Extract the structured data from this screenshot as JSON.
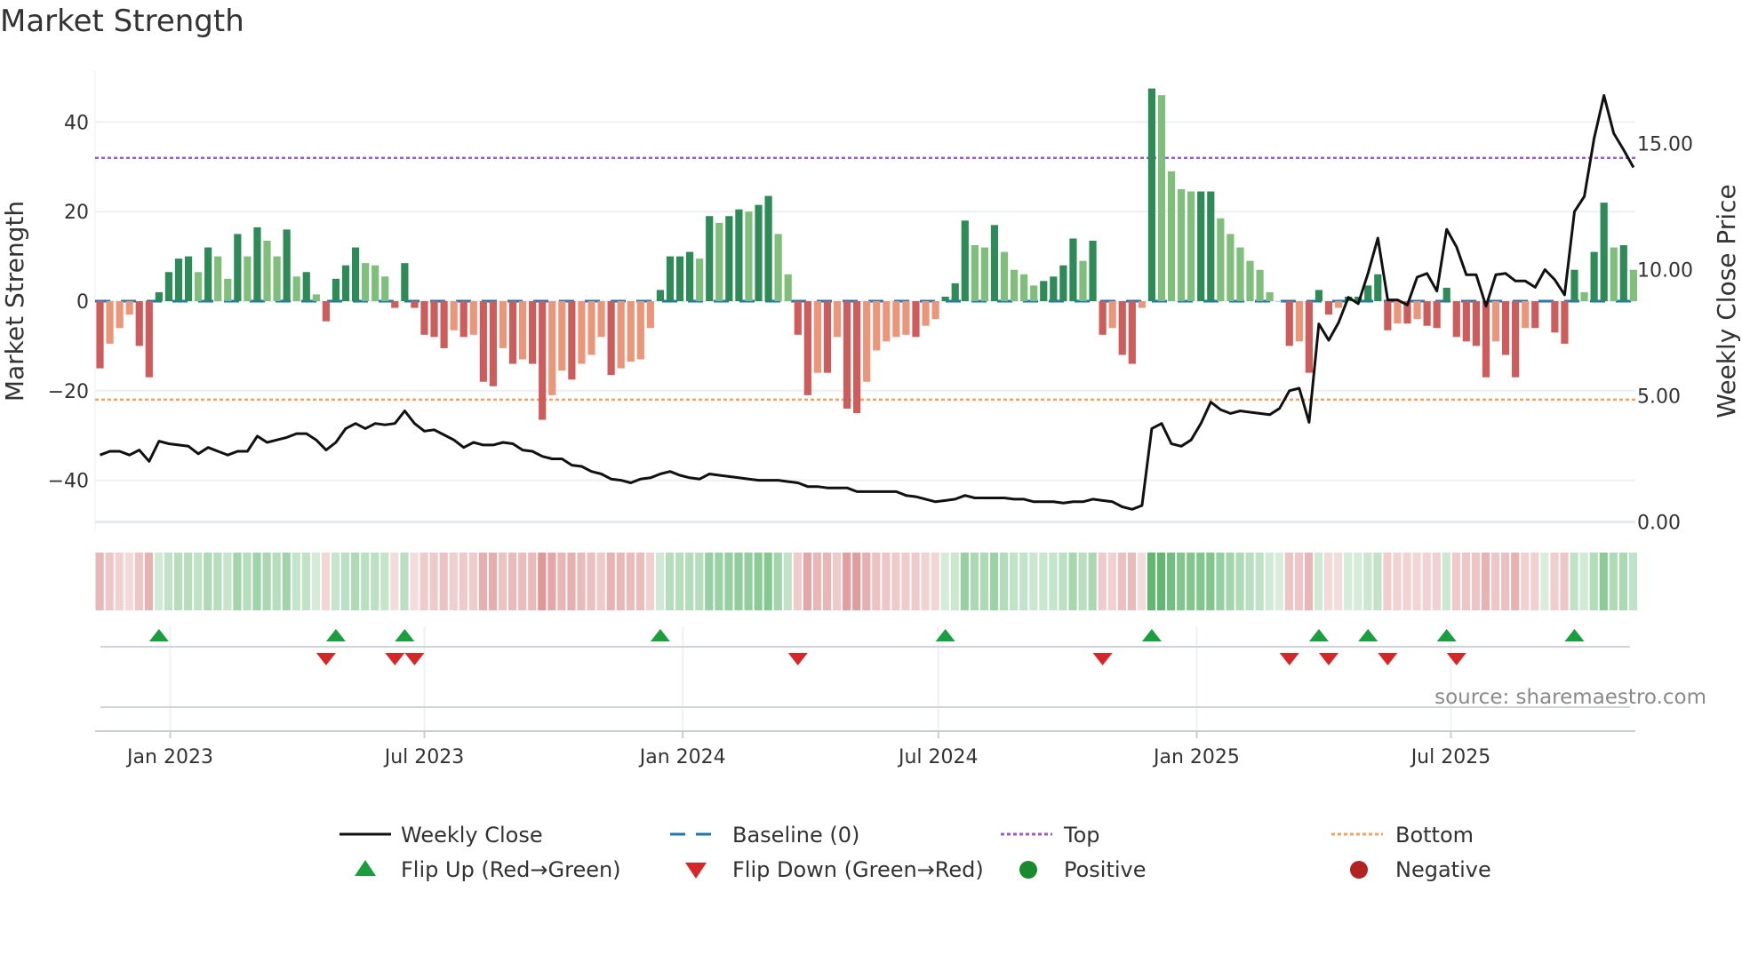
{
  "title": "Market Strength",
  "source": "source: sharemaestro.com",
  "chart_data": {
    "type": "bar",
    "title": "Market Strength",
    "start_date": "2022-11-12",
    "frequency": "weekly",
    "ylabel": "Market Strength",
    "y2label": "Weekly Close Price",
    "ylim": [
      -50,
      52
    ],
    "y2lim": [
      0,
      20.6
    ],
    "yticks": [
      {
        "v": 40,
        "label": "40"
      },
      {
        "v": 20,
        "label": "20"
      },
      {
        "v": 0,
        "label": "0"
      },
      {
        "v": -20,
        "label": "−20"
      },
      {
        "v": -40,
        "label": "−40"
      }
    ],
    "y2ticks": [
      {
        "v": 15,
        "label": "15.00"
      },
      {
        "v": 10,
        "label": "10.00"
      },
      {
        "v": 5,
        "label": "5.00"
      },
      {
        "v": 0,
        "label": "0.00"
      }
    ],
    "xticks": [
      {
        "label": "Jan 2023",
        "date": "2023-01-01"
      },
      {
        "label": "Jul 2023",
        "date": "2023-07-01"
      },
      {
        "label": "Jan 2024",
        "date": "2024-01-01"
      },
      {
        "label": "Jul 2024",
        "date": "2024-07-01"
      },
      {
        "label": "Jan 2025",
        "date": "2025-01-01"
      },
      {
        "label": "Jul 2025",
        "date": "2025-07-01"
      }
    ],
    "top_level": 32,
    "bottom_level": -22,
    "baseline": 0,
    "strength": [
      -15,
      -9.5,
      -6,
      -3,
      -10,
      -17,
      2,
      6.5,
      9.5,
      10,
      6.5,
      12,
      10,
      5,
      15,
      10,
      16.5,
      13.5,
      10,
      16,
      5.5,
      6.5,
      1.5,
      -4.5,
      5,
      8,
      12,
      8.5,
      8,
      5.5,
      -1.5,
      8.5,
      -1.5,
      -7.5,
      -8,
      -10.5,
      -6.5,
      -8,
      -7.5,
      -18,
      -19,
      -10.5,
      -14,
      -13,
      -14,
      -26.5,
      -21,
      -15.5,
      -17.5,
      -14,
      -12,
      -8,
      -16.5,
      -15,
      -13.5,
      -13,
      -6,
      2.5,
      10,
      10,
      11,
      9.5,
      19,
      17.5,
      19,
      20.5,
      20,
      21.5,
      23.5,
      15,
      6,
      -7.5,
      -21,
      -16,
      -16,
      -8,
      -24,
      -25,
      -18,
      -11,
      -9,
      -8,
      -7.5,
      -8,
      -5.5,
      -4,
      1,
      4,
      18,
      12.5,
      12,
      17,
      11,
      7,
      6,
      3.5,
      4.5,
      5.5,
      8,
      14,
      9,
      13.5,
      -7.5,
      -6,
      -12,
      -14,
      -1.5,
      47.5,
      46,
      29,
      25,
      24.5,
      24.5,
      24.5,
      18.5,
      15,
      12,
      9,
      7,
      2,
      0,
      -10,
      -9,
      -16,
      2.5,
      -3,
      -1.5,
      1,
      1,
      3.5,
      6,
      -6.5,
      -5,
      -5,
      -4,
      -5.5,
      -6,
      3,
      -8,
      -9,
      -10,
      -17,
      -9,
      -12,
      -17,
      -6,
      -6,
      0,
      -7,
      -9.5,
      7,
      2,
      11,
      22,
      12,
      12.5,
      7
    ],
    "weekly_close": [
      2.65,
      2.8,
      2.8,
      2.65,
      2.85,
      2.4,
      3.2,
      3.1,
      3.05,
      3.0,
      2.7,
      2.95,
      2.8,
      2.65,
      2.8,
      2.8,
      3.4,
      3.15,
      3.25,
      3.35,
      3.5,
      3.5,
      3.25,
      2.85,
      3.15,
      3.7,
      3.9,
      3.7,
      3.9,
      3.85,
      3.9,
      4.4,
      3.9,
      3.6,
      3.65,
      3.45,
      3.25,
      2.95,
      3.15,
      3.05,
      3.05,
      3.15,
      3.1,
      2.85,
      2.8,
      2.6,
      2.5,
      2.5,
      2.25,
      2.2,
      2.0,
      1.9,
      1.7,
      1.65,
      1.55,
      1.7,
      1.75,
      1.9,
      2.0,
      1.85,
      1.75,
      1.7,
      1.9,
      1.85,
      1.8,
      1.75,
      1.7,
      1.65,
      1.65,
      1.65,
      1.6,
      1.55,
      1.4,
      1.4,
      1.35,
      1.35,
      1.35,
      1.2,
      1.2,
      1.2,
      1.2,
      1.2,
      1.05,
      1.0,
      0.9,
      0.8,
      0.85,
      0.9,
      1.05,
      0.95,
      0.95,
      0.95,
      0.95,
      0.9,
      0.9,
      0.8,
      0.8,
      0.8,
      0.75,
      0.8,
      0.8,
      0.9,
      0.85,
      0.8,
      0.6,
      0.5,
      0.65,
      3.7,
      3.9,
      3.1,
      3.0,
      3.25,
      3.9,
      4.75,
      4.45,
      4.3,
      4.4,
      4.35,
      4.3,
      4.25,
      4.5,
      5.2,
      5.3,
      3.95,
      7.85,
      7.2,
      7.9,
      8.9,
      8.65,
      9.85,
      11.25,
      8.8,
      8.8,
      8.6,
      9.7,
      9.85,
      9.15,
      11.6,
      10.9,
      9.8,
      9.8,
      8.55,
      9.8,
      9.85,
      9.55,
      9.55,
      9.3,
      10.0,
      9.6,
      9.0,
      12.3,
      12.9,
      15.2,
      16.9,
      15.4,
      14.75,
      14.05
    ],
    "flip_up_weeks": [
      6,
      24,
      31,
      57,
      86,
      107,
      124,
      129,
      137,
      150
    ],
    "flip_down_weeks": [
      23,
      30,
      32,
      71,
      102,
      121,
      125,
      131,
      138
    ],
    "legend": {
      "weekly_close": "Weekly Close",
      "baseline": "Baseline (0)",
      "top": "Top",
      "bottom": "Bottom",
      "flip_up": "Flip Up (Red→Green)",
      "flip_down": "Flip Down (Green→Red)",
      "positive": "Positive",
      "negative": "Negative"
    },
    "legend_position": "bottom",
    "grid": true
  },
  "colors": {
    "pos_strong": "#2e8b57",
    "pos_weak": "#7fbf7b",
    "neg_strong": "#cd5c5c",
    "neg_weak": "#e9967a",
    "baseline": "#1f77b4",
    "top": "#9b59d6",
    "bottom": "#f4a261",
    "flip_up": "#1a9e3f",
    "flip_down": "#d62728",
    "positive": "#1a8a2e",
    "negative": "#b22222",
    "close": "#111111"
  }
}
